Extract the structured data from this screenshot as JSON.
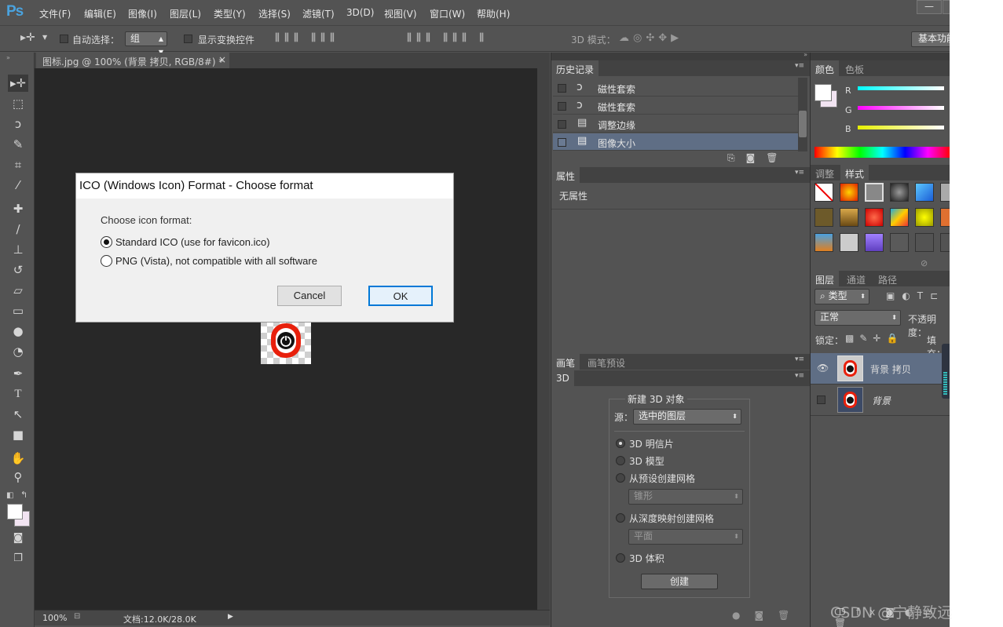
{
  "app": {
    "logo": "Ps"
  },
  "menu": [
    "文件(F)",
    "编辑(E)",
    "图像(I)",
    "图层(L)",
    "类型(Y)",
    "选择(S)",
    "滤镜(T)",
    "3D(D)",
    "视图(V)",
    "窗口(W)",
    "帮助(H)"
  ],
  "window_controls": {
    "minimize": "—",
    "restore": "□"
  },
  "options_bar": {
    "auto_select_label": "自动选择：",
    "auto_select_value": "组",
    "show_transform_label": "显示变换控件",
    "mode_3d_label": "3D 模式：",
    "workspace_label": "基本功能"
  },
  "document": {
    "tab_title": "图标.jpg @ 100% (背景 拷贝, RGB/8#) *",
    "tab_close": "×",
    "zoom": "100%",
    "doc_size": "文档:12.0K/28.0K"
  },
  "dialog": {
    "title": "ICO (Windows Icon) Format - Choose format",
    "prompt": "Choose icon format:",
    "options": [
      {
        "label": "Standard ICO (use for favicon.ico)",
        "selected": true
      },
      {
        "label": "PNG (Vista), not compatible with all software",
        "selected": false
      }
    ],
    "cancel_label": "Cancel",
    "ok_label": "OK"
  },
  "history_panel": {
    "tab": "历史记录",
    "items": [
      {
        "label": "磁性套索",
        "icon": "magnetic-lasso-icon",
        "selected": false
      },
      {
        "label": "磁性套索",
        "icon": "magnetic-lasso-icon",
        "selected": false
      },
      {
        "label": "调整边缘",
        "icon": "document-icon",
        "selected": false
      },
      {
        "label": "图像大小",
        "icon": "document-icon",
        "selected": true
      }
    ]
  },
  "properties_panel": {
    "tab": "属性",
    "content": "无属性"
  },
  "brush_panel": {
    "tabs": [
      "画笔",
      "画笔预设"
    ]
  },
  "panel_3d": {
    "tab": "3D",
    "group_title": "新建 3D 对象",
    "source_label": "源：",
    "source_value": "选中的图层",
    "options": [
      {
        "label": "3D 明信片",
        "selected": true
      },
      {
        "label": "3D 模型",
        "selected": false
      },
      {
        "label": "从预设创建网格",
        "selected": false
      },
      {
        "label": "从深度映射创建网格",
        "selected": false
      },
      {
        "label": "3D 体积",
        "selected": false
      }
    ],
    "preset_value": "锥形",
    "depth_value": "平面",
    "create_label": "创建"
  },
  "color_panel": {
    "tabs": [
      "颜色",
      "色板"
    ],
    "channels": [
      "R",
      "G",
      "B"
    ]
  },
  "styles_panel": {
    "tabs": [
      "调整",
      "样式"
    ]
  },
  "layers_panel": {
    "tabs": [
      "图层",
      "通道",
      "路径"
    ],
    "filter_label": "类型",
    "blend_mode": "正常",
    "opacity_label": "不透明度：",
    "lock_label": "锁定：",
    "fill_label": "填充：",
    "layers": [
      {
        "name": "背景 拷贝",
        "visible": true,
        "selected": true
      },
      {
        "name": "背景",
        "visible": false,
        "selected": false
      }
    ]
  },
  "watermark": "CSDN @宁静致远"
}
